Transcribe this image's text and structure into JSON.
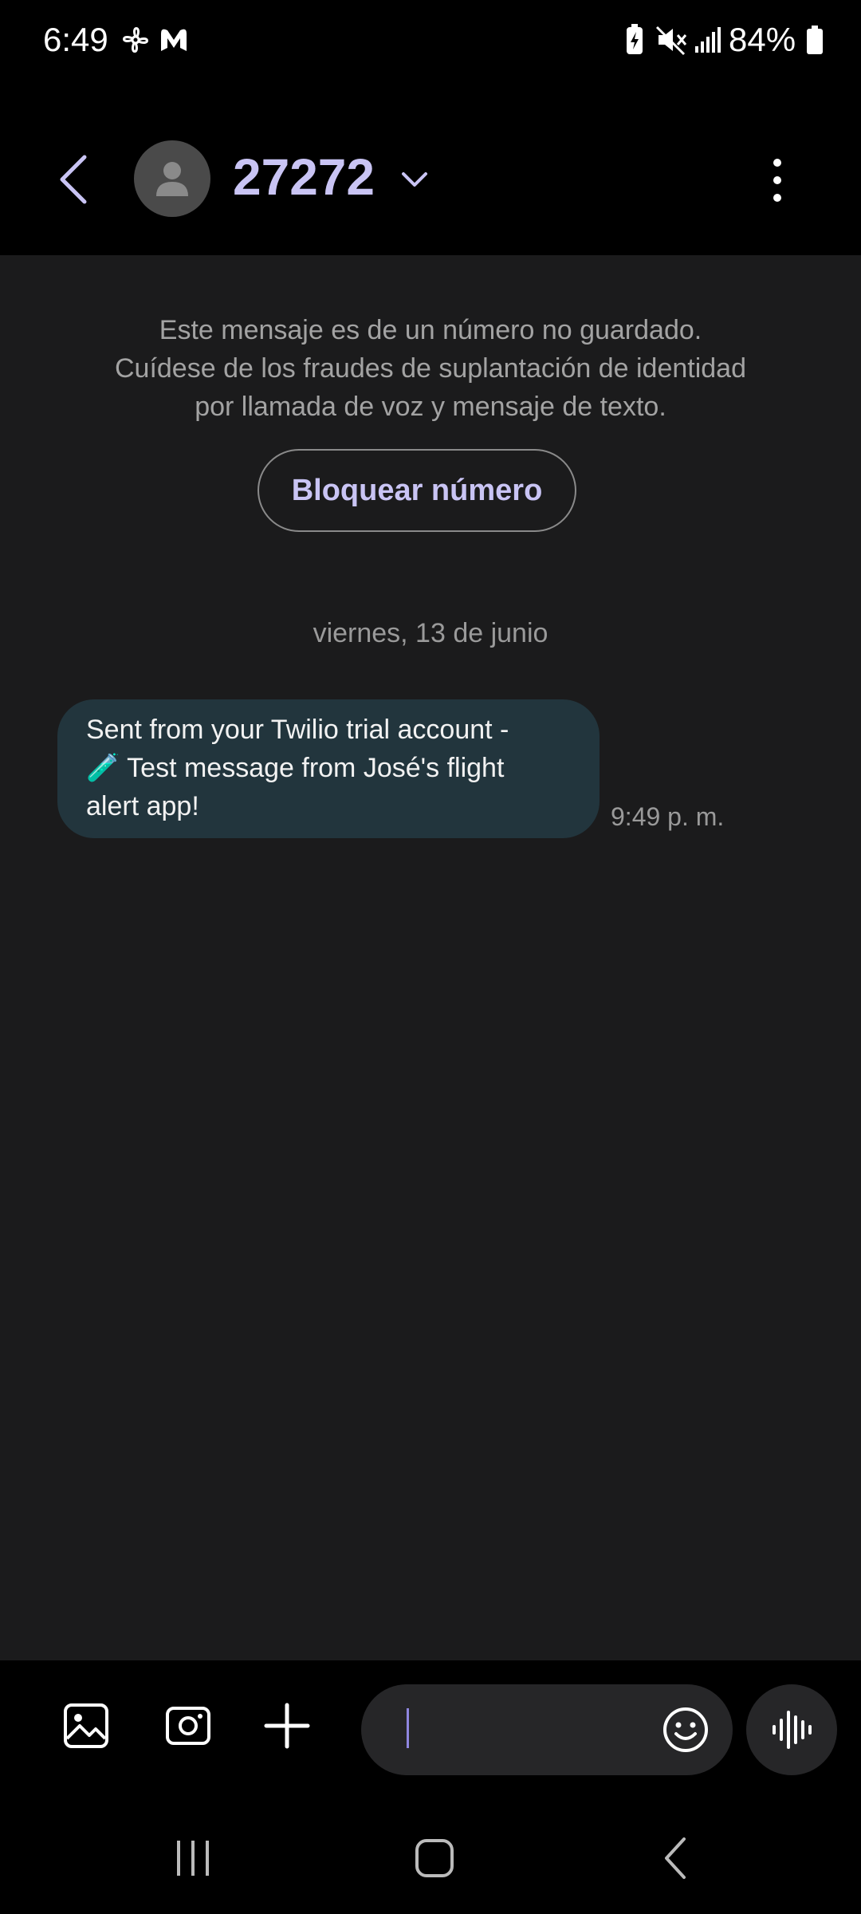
{
  "status_bar": {
    "time": "6:49",
    "battery_percent": "84%",
    "icons": [
      "fan-icon",
      "malwarebytes-icon",
      "battery-saver-icon",
      "mute-icon",
      "signal-icon",
      "battery-icon"
    ]
  },
  "header": {
    "contact_name": "27272",
    "icons": [
      "back-arrow-icon",
      "avatar-person-icon",
      "chevron-down-icon",
      "more-options-icon"
    ]
  },
  "conversation": {
    "notice_lines": [
      "Este mensaje es de un número no guardado.",
      "Cuídese de los fraudes de suplantación de identidad",
      "por llamada de voz y mensaje de texto."
    ],
    "block_button_label": "Bloquear número",
    "date_separator": "viernes, 13 de junio",
    "messages": [
      {
        "lines": [
          "Sent from your Twilio trial account -",
          "🧪 Test message from José's flight",
          "alert app!"
        ],
        "time": "9:49 p. m."
      }
    ]
  },
  "composer": {
    "input_value": "",
    "input_placeholder": "",
    "icons": [
      "gallery-icon",
      "camera-icon",
      "plus-icon",
      "emoji-icon",
      "voice-waveform-icon"
    ]
  },
  "nav_bar": {
    "icons": [
      "recent-apps-icon",
      "home-icon",
      "back-icon"
    ]
  },
  "colors": {
    "accent": "#c9c4f4",
    "bubble_incoming": "#22353d",
    "conversation_bg": "#1b1b1c",
    "chrome_bg": "#000000",
    "secondary_text": "#a3a3a3"
  }
}
